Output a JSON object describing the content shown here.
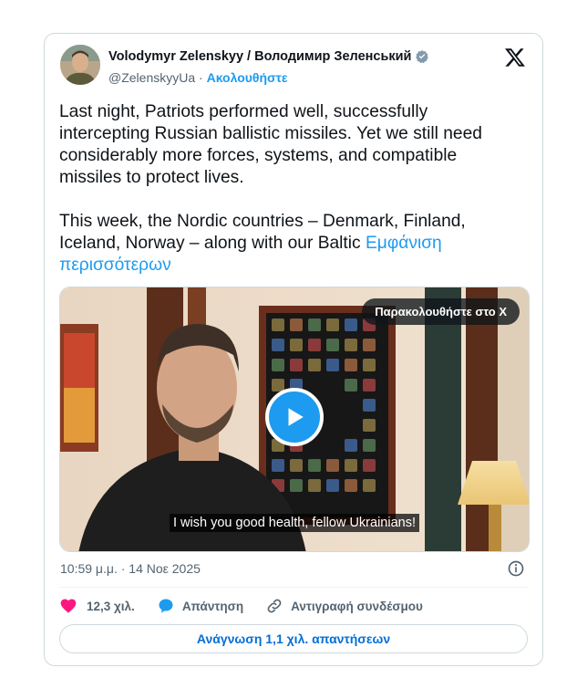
{
  "author": {
    "name": "Volodymyr Zelenskyy / Володимир Зеленський",
    "handle": "@ZelenskyyUa",
    "separator": "·",
    "follow_label": "Ακολουθήστε"
  },
  "tweet": {
    "paragraph1": "Last night, Patriots performed well, successfully intercepting Russian ballistic missiles. Yet we still need considerably more forces, systems, and compatible missiles to protect lives.",
    "paragraph2": "This week, the Nordic countries – Denmark, Finland, Iceland, Norway – along with our Baltic",
    "show_more": "Εμφάνιση περισσότερων"
  },
  "media": {
    "watch_label": "Παρακολουθήστε στο X",
    "subtitle": "I wish you good health, fellow Ukrainians!"
  },
  "meta": {
    "timestamp": "10:59 μ.μ. · 14 Νοε 2025"
  },
  "actions": {
    "like_count": "12,3 χιλ.",
    "reply_label": "Απάντηση",
    "copy_link_label": "Αντιγραφή συνδέσμου"
  },
  "footer": {
    "read_replies_label": "Ανάγνωση 1,1 χιλ. απαντήσεων"
  },
  "colors": {
    "accent": "#1d9bf0",
    "like": "#f91880",
    "muted": "#536471",
    "border": "#cfd9de"
  }
}
